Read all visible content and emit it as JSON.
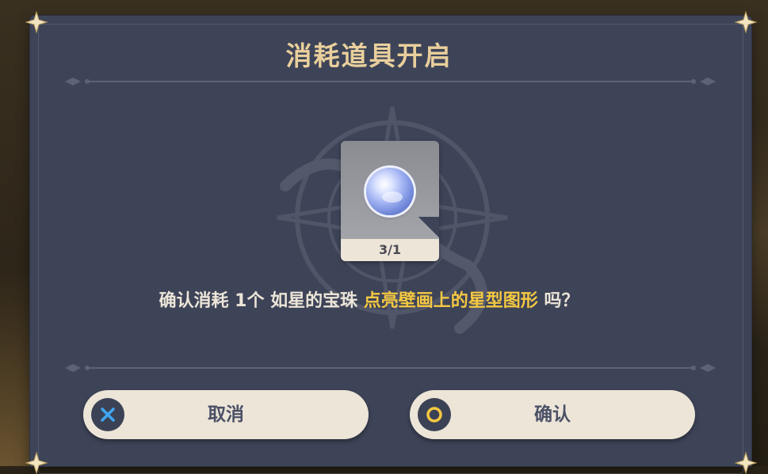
{
  "dialog": {
    "title": "消耗道具开启",
    "item": {
      "name": "如星的宝珠",
      "count": "3/1",
      "icon": "blue-orb-icon"
    },
    "message": {
      "prefix": "确认消耗 1个 如星的宝珠 ",
      "highlight": "点亮壁画上的星型图形",
      "suffix": " 吗？"
    },
    "buttons": {
      "cancel": {
        "label": "取消",
        "icon": "cross-icon"
      },
      "confirm": {
        "label": "确认",
        "icon": "circle-icon"
      }
    }
  },
  "colors": {
    "panel": "#3e4458",
    "title": "#e9cf9c",
    "highlight": "#f5c842",
    "button_bg": "#ece5d8",
    "cross_icon": "#3fa7f2",
    "circle_icon": "#f5c842"
  }
}
